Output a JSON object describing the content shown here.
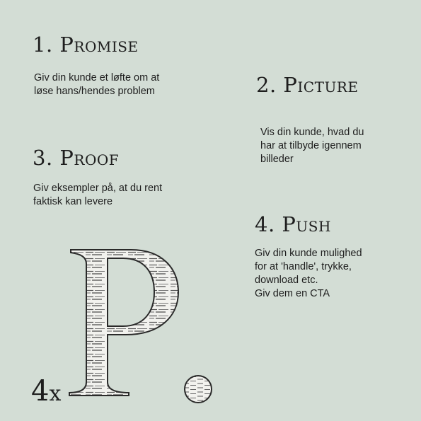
{
  "sections": [
    {
      "heading": "1. Promise",
      "lines": [
        "Giv din kunde et løfte om at",
        "løse hans/hendes problem"
      ]
    },
    {
      "heading": "2. Picture",
      "lines": [
        "Vis din kunde, hvad du",
        "har at tilbyde igennem",
        "billeder"
      ]
    },
    {
      "heading": "3. Proof",
      "lines": [
        "Giv eksempler på, at du rent",
        "faktisk kan levere"
      ]
    },
    {
      "heading": "4. Push",
      "lines": [
        "Giv din kunde mulighed",
        "for at 'handle', trykke,",
        "download etc.",
        "Giv dem en CTA"
      ]
    }
  ],
  "badge": {
    "number": "4",
    "suffix": "x"
  },
  "icons": {
    "logo": "newspaper-letter-p-logo"
  },
  "colors": {
    "background": "#d3ddd5",
    "text": "#1e1e1e"
  }
}
